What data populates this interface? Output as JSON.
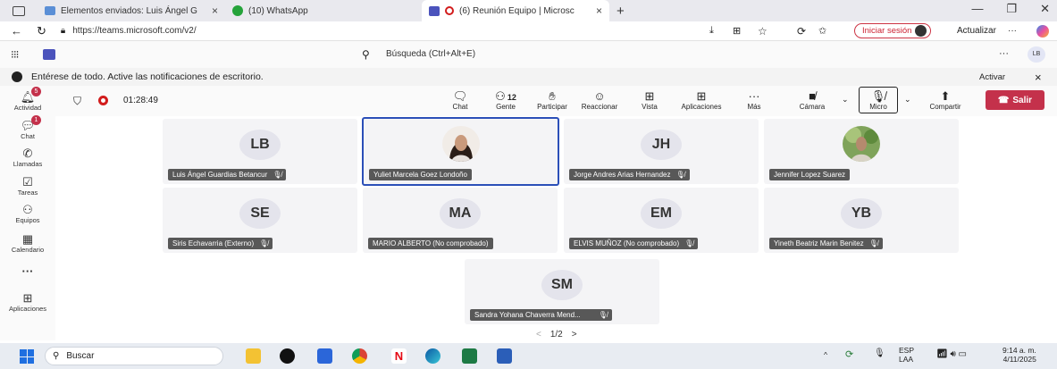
{
  "browser": {
    "tabs": [
      {
        "label": "Elementos enviados: Luis Ángel G",
        "close": "×"
      },
      {
        "label": "(10) WhatsApp"
      },
      {
        "label": "(6) Reunión Equipo | Microsc",
        "close": "×"
      }
    ],
    "new_tab": "+",
    "url": "https://teams.microsoft.com/v2/",
    "signin_label": "Iniciar sesión",
    "update_label": "Actualizar",
    "more": "···"
  },
  "teams": {
    "search_placeholder": "Búsqueda (Ctrl+Alt+E)",
    "user_initials": "LB",
    "more": "···"
  },
  "notification": {
    "text": "Entérese de todo. Active las notificaciones de escritorio.",
    "action": "Activar",
    "close": "×"
  },
  "rail": [
    {
      "label": "Actividad",
      "icon": "bell-icon",
      "badge": "5"
    },
    {
      "label": "Chat",
      "icon": "chat-icon",
      "badge": "1"
    },
    {
      "label": "Llamadas",
      "icon": "phone-icon"
    },
    {
      "label": "Tareas",
      "icon": "tasks-icon"
    },
    {
      "label": "Equipos",
      "icon": "teams-icon"
    },
    {
      "label": "Calendario",
      "icon": "calendar-icon"
    },
    {
      "label": "···",
      "icon": "more-icon"
    },
    {
      "label": "Aplicaciones",
      "icon": "apps-icon"
    }
  ],
  "meeting": {
    "timer": "01:28:49",
    "tools": [
      {
        "label": "Chat",
        "icon": "chat-icon"
      },
      {
        "label": "Gente",
        "icon": "people-icon",
        "count": "12"
      },
      {
        "label": "Participar",
        "icon": "hand-icon"
      },
      {
        "label": "Reaccionar",
        "icon": "emoji-icon"
      },
      {
        "label": "Vista",
        "icon": "grid-icon"
      },
      {
        "label": "Aplicaciones",
        "icon": "apps-icon"
      },
      {
        "label": "Más",
        "icon": "more-icon"
      },
      {
        "label": "Cámara",
        "icon": "camera-off-icon"
      },
      {
        "label": "Micro",
        "icon": "mic-off-icon"
      },
      {
        "label": "Compartir",
        "icon": "share-icon"
      }
    ],
    "leave": "Salir"
  },
  "participants": [
    {
      "initials": "LB",
      "name": "Luis Ángel Guardias Betancur",
      "muted": true
    },
    {
      "initials": "",
      "name": "Yuliet Marcela Goez Londoño",
      "muted": false,
      "photo": true,
      "speaking": true
    },
    {
      "initials": "JH",
      "name": "Jorge Andres Arias Hernandez",
      "muted": true
    },
    {
      "initials": "",
      "name": "Jennifer Lopez Suarez",
      "muted": false,
      "photo": true
    },
    {
      "initials": "SE",
      "name": "Siris Echavarria (Externo)",
      "muted": true
    },
    {
      "initials": "MA",
      "name": "MARIO ALBERTO (No comprobado)",
      "muted": false
    },
    {
      "initials": "EM",
      "name": "ELVIS MUÑOZ (No comprobado)",
      "muted": true
    },
    {
      "initials": "YB",
      "name": "Yineth Beatriz Marin Benitez",
      "muted": true
    },
    {
      "initials": "SM",
      "name": "Sandra Yohana Chaverra Mend...",
      "muted": true
    }
  ],
  "pager": {
    "page": "1/2",
    "prev": "<",
    "next": ">"
  },
  "taskbar": {
    "search": "Buscar",
    "lang": "ESP",
    "layout": "LAA",
    "time": "9:14 a. m.",
    "date": "4/11/2025"
  }
}
